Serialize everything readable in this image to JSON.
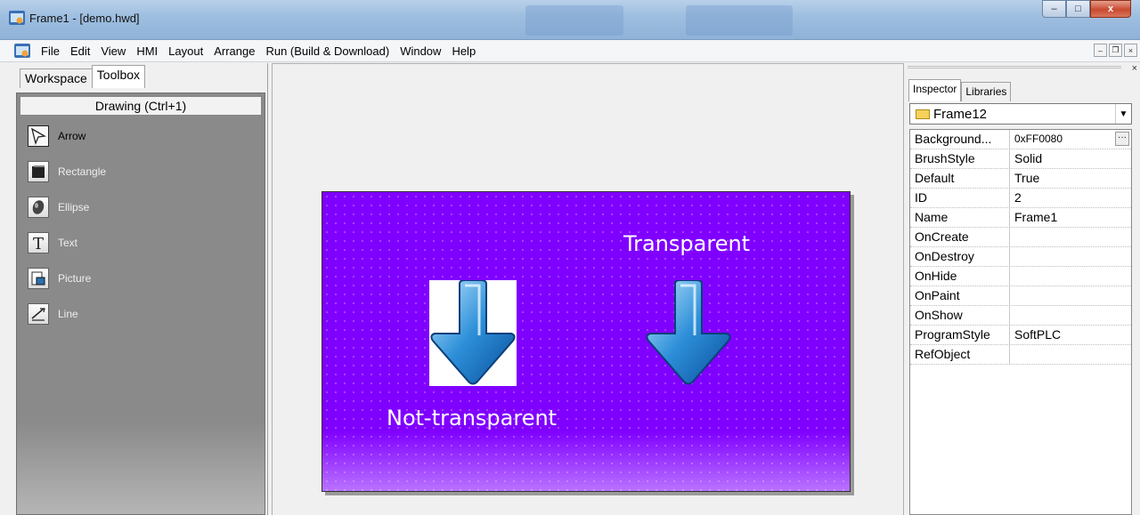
{
  "window": {
    "title": "Frame1 - [demo.hwd]",
    "controls": {
      "minimize": "–",
      "maximize": "□",
      "close": "x"
    }
  },
  "menubar": {
    "items": [
      "File",
      "Edit",
      "View",
      "HMI",
      "Layout",
      "Arrange",
      "Run (Build & Download)",
      "Window",
      "Help"
    ]
  },
  "mdi_controls": {
    "minimize": "–",
    "restore": "❐",
    "close": "×"
  },
  "left_panel": {
    "tabs": [
      "Workspace",
      "Toolbox"
    ],
    "active_tab": "Toolbox",
    "section_header": "Drawing (Ctrl+1)",
    "tools": [
      {
        "label": "Arrow",
        "icon": "arrow-cursor-icon"
      },
      {
        "label": "Rectangle",
        "icon": "rectangle-icon"
      },
      {
        "label": "Ellipse",
        "icon": "ellipse-icon"
      },
      {
        "label": "Text",
        "icon": "text-icon"
      },
      {
        "label": "Picture",
        "icon": "picture-icon"
      },
      {
        "label": "Line",
        "icon": "line-icon"
      }
    ]
  },
  "canvas": {
    "frame_background": "#8000FF",
    "label_transparent": "Transparent",
    "label_not_transparent": "Not-transparent"
  },
  "right_panel": {
    "close": "×",
    "tabs": [
      "Inspector",
      "Libraries"
    ],
    "active_tab": "Inspector",
    "object_selector": "Frame12",
    "properties": [
      {
        "name": "Background...",
        "value": "0xFF0080"
      },
      {
        "name": "BrushStyle",
        "value": "Solid"
      },
      {
        "name": "Default",
        "value": "True"
      },
      {
        "name": "ID",
        "value": "2"
      },
      {
        "name": "Name",
        "value": "Frame1"
      },
      {
        "name": "OnCreate",
        "value": ""
      },
      {
        "name": "OnDestroy",
        "value": ""
      },
      {
        "name": "OnHide",
        "value": ""
      },
      {
        "name": "OnPaint",
        "value": ""
      },
      {
        "name": "OnShow",
        "value": ""
      },
      {
        "name": "ProgramStyle",
        "value": "SoftPLC"
      },
      {
        "name": "RefObject",
        "value": ""
      }
    ]
  }
}
